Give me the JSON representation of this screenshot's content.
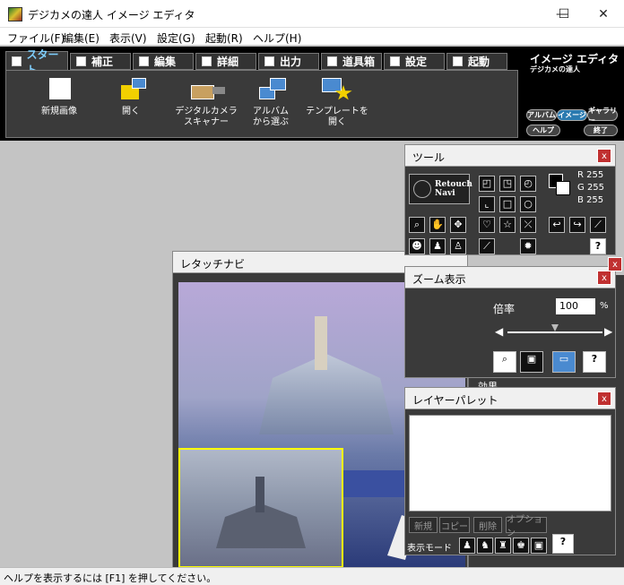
{
  "window": {
    "title": "デジカメの達人 イメージ エディタ",
    "minimize": "—",
    "maximize": "☐",
    "close": "✕"
  },
  "menu": [
    "ファイル(F)",
    "編集(E)",
    "表示(V)",
    "設定(G)",
    "起動(R)",
    "ヘルプ(H)"
  ],
  "tabs": [
    "スタート",
    "補正",
    "編集",
    "詳細",
    "出力",
    "道具箱",
    "設定",
    "起動"
  ],
  "toolbar": [
    {
      "label": "新規画像",
      "icon": "new-image-icon"
    },
    {
      "label": "開く",
      "icon": "open-folder-icon"
    },
    {
      "label": "デジタルカメラ\nスキャナー",
      "icon": "camera-scanner-icon"
    },
    {
      "label": "アルバム\nから選ぶ",
      "icon": "album-icon"
    },
    {
      "label": "テンプレートを\n開く",
      "icon": "template-icon"
    }
  ],
  "brand": {
    "title": "イメージ エディタ",
    "subtitle": "デジカメの達人",
    "links": [
      "アルバム",
      "イメージ",
      "ギャラリー"
    ],
    "help": "ヘルプ",
    "exit": "終了"
  },
  "tool_panel": {
    "title": "ツール",
    "close": "x",
    "retouch_label": "Retouch Navi",
    "rgb": {
      "r_label": "R",
      "r": "255",
      "g_label": "G",
      "g": "255",
      "b_label": "B",
      "b": "255"
    }
  },
  "retouch_panel": {
    "title": "レタッチナビ",
    "effect_label": "効果"
  },
  "zoom_panel": {
    "title": "ズーム表示",
    "close": "x",
    "rate_label": "倍率",
    "rate_value": "100",
    "percent": "%",
    "slider_level": 0.5
  },
  "layer_panel": {
    "title": "レイヤーパレット",
    "close": "x",
    "buttons": [
      "新規",
      "コピー",
      "削除",
      "オプション"
    ],
    "mode_label": "表示モード"
  },
  "status": {
    "text": "ヘルプを表示するには [F1] を押してください。"
  },
  "colors": {
    "ribbon_bg": "#000000",
    "active_tab": "#7fd0ff",
    "close_red": "#c03030",
    "thumb_border": "#ffff00"
  }
}
